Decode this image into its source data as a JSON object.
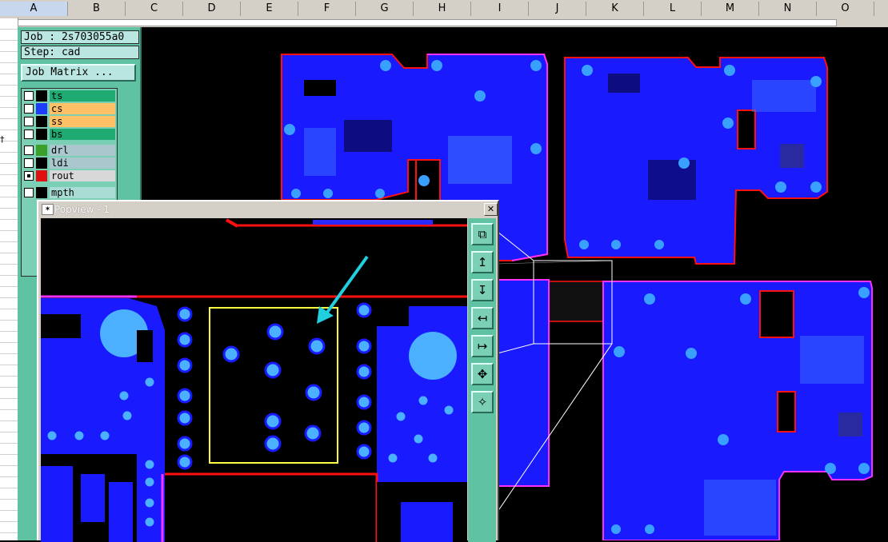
{
  "spreadsheet": {
    "columns": [
      "A",
      "B",
      "C",
      "D",
      "E",
      "F",
      "G",
      "H",
      "I",
      "J",
      "K",
      "L",
      "M",
      "N",
      "O"
    ],
    "selected_column": "A",
    "row_marker": "†"
  },
  "job": {
    "job_label": "Job : 2s703055a0",
    "step_label": "Step: cad",
    "matrix_button": "Job Matrix ..."
  },
  "layers": [
    {
      "name": "ts",
      "color": "#000000",
      "bg": "#1faa72",
      "checked": false
    },
    {
      "name": "cs",
      "color": "#1e3cff",
      "bg": "#ffc066",
      "checked": false
    },
    {
      "name": "ss",
      "color": "#000000",
      "bg": "#ffc066",
      "checked": false
    },
    {
      "name": "bs",
      "color": "#000000",
      "bg": "#1faa72",
      "checked": false
    },
    {
      "name": "drl",
      "color": "#3aa02a",
      "bg": "#a9c7cc",
      "checked": false
    },
    {
      "name": "ldi",
      "color": "#000000",
      "bg": "#a9c7cc",
      "checked": false
    },
    {
      "name": "rout",
      "color": "#e01010",
      "bg": "#d8d8d8",
      "checked": true,
      "suffix": "⊞"
    },
    {
      "name": "mpth",
      "color": "#000000",
      "bg": "#a9dcd4",
      "checked": false
    }
  ],
  "popview": {
    "title": "Popview - 1",
    "close": "✕",
    "tools": [
      "zoom-fit-icon",
      "pan-up-icon",
      "pan-down-icon",
      "pan-left-icon",
      "pan-right-icon",
      "zoom-in-icon",
      "zoom-out-icon"
    ]
  },
  "colors": {
    "copper": "#1a1aff",
    "pad": "#3aa0ff",
    "rout": "#ff1010",
    "board_outline": "#ff30ff",
    "highlight_box": "#ffff40",
    "arrow": "#20d0e0",
    "panel": "#5fc3a3"
  }
}
